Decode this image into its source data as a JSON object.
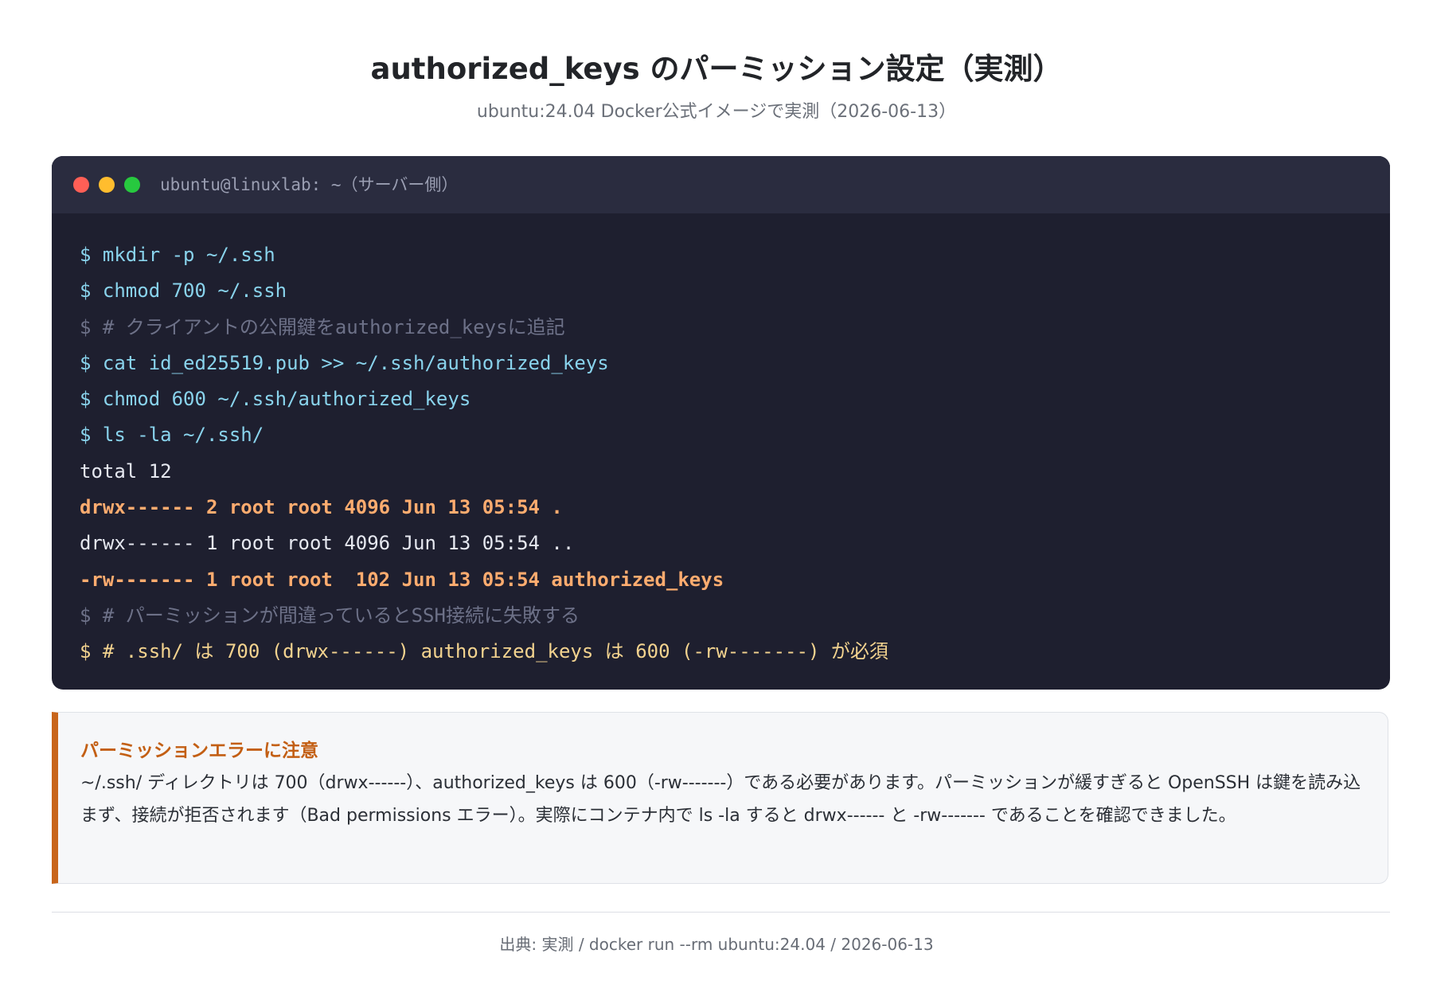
{
  "header": {
    "title": "authorized_keys のパーミッション設定（実測）",
    "subtitle": "ubuntu:24.04 Docker公式イメージで実測（2026-06-13）"
  },
  "terminal": {
    "window_title": "ubuntu@linuxlab: ~（サーバー側）",
    "lines": [
      {
        "type": "cmd",
        "text": "$ mkdir -p ~/.ssh"
      },
      {
        "type": "cmd",
        "text": "$ chmod 700 ~/.ssh"
      },
      {
        "type": "comment",
        "text": "$ # クライアントの公開鍵をauthorized_keysに追記"
      },
      {
        "type": "cmd",
        "text": "$ cat id_ed25519.pub >> ~/.ssh/authorized_keys"
      },
      {
        "type": "cmd",
        "text": "$ chmod 600 ~/.ssh/authorized_keys"
      },
      {
        "type": "cmd",
        "text": "$ ls -la ~/.ssh/"
      },
      {
        "type": "out",
        "text": "total 12"
      },
      {
        "type": "hl",
        "text": "drwx------ 2 root root 4096 Jun 13 05:54 ."
      },
      {
        "type": "out",
        "text": "drwx------ 1 root root 4096 Jun 13 05:54 .."
      },
      {
        "type": "hl",
        "text": "-rw------- 1 root root  102 Jun 13 05:54 authorized_keys"
      },
      {
        "type": "comment",
        "text": "$ # パーミッションが間違っているとSSH接続に失敗する"
      },
      {
        "type": "note",
        "text": "$ # .ssh/ は 700 (drwx------) authorized_keys は 600 (-rw-------) が必須"
      }
    ]
  },
  "callout": {
    "title": "パーミッションエラーに注意",
    "text": "~/.ssh/ ディレクトリは 700（drwx------）、authorized_keys は 600（-rw-------）である必要があります。パーミッションが緩すぎると OpenSSH は鍵を読み込まず、接続が拒否されます（Bad permissions エラー）。実際にコンテナ内で ls -la すると drwx------ と -rw------- であることを確認できました。"
  },
  "footer": {
    "source": "出典: 実測 / docker run --rm ubuntu:24.04 / 2026-06-13"
  },
  "colors": {
    "terminal_bg": "#1e1f2f",
    "accent": "#c8651b",
    "command": "#89d3ec",
    "highlight": "#ffac6f"
  }
}
